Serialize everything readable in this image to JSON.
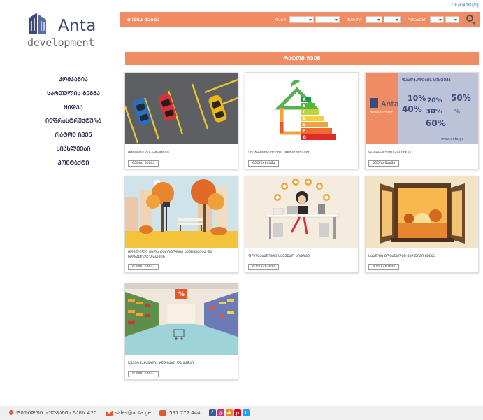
{
  "lang_switch": "GE/EN/RU/TJ",
  "logo": {
    "name": "Anta",
    "sub": "development"
  },
  "nav": [
    "ᲙᲝᲛᲞᲐᲜᲘᲐ",
    "ᲡᲐᲠᲗᲣᲚᲘᲡ ᲒᲔᲒᲛᲐ",
    "ᲧᲘᲓᲕᲐ",
    "ᲘᲜᲤᲠᲐᲡᲢᲠᲣᲥᲢᲣᲠᲐ",
    "ᲠᲐᲢᲝᲛ ᲩᲕᲔᲜ",
    "ᲡᲘᲐᲮᲚᲔᲔᲑᲘ",
    "ᲙᲝᲜᲢᲐᲥᲢᲘ"
  ],
  "search": {
    "title": "ᲑᲘᲜᲘᲡ ᲫᲔᲑᲜᲐ",
    "filter1": "ᲤᲐᲡᲘ",
    "filter2": "ᲤᲐᲠᲗᲘ",
    "filter3": "ᲝᲗᲐᲮᲔᲑᲘ",
    "icon": "search-icon"
  },
  "section_title": "ᲠᲐᲢᲝᲛ ᲩᲕᲔᲜ",
  "cards": [
    {
      "title": "ᲛᲘᲬᲘᲡᲥᲕᲔᲨᲐ ᲞᲐᲠᲙᲘᲜᲒᲘ",
      "button": "ᲛᲔᲢᲘᲡ ᲜᲐᲮᲕᲐ"
    },
    {
      "title": "ᲔᲜᲔᲠᲒᲝᲔᲤᲔᲥᲢᲣᲠᲘ ᲙᲝᲛᲞᲚᲔᲥᲡᲔᲑᲘ",
      "button": "ᲛᲔᲢᲘᲡ ᲜᲐᲮᲕᲐ"
    },
    {
      "title": "ᲤᲐᲡᲓᲐᲙᲚᲔᲑᲘᲡ ᲡᲘᲡᲢᲔᲛᲐ",
      "button": "ᲛᲔᲢᲘᲡ ᲜᲐᲮᲕᲐ"
    },
    {
      "title": "ᲛᲝᲕᲚᲘᲚᲘ ᲔᲖᲝᲡ ᲢᲔᲠᲘᲢᲝᲠᲘᲐ ᲑᲐᲕᲨᲕᲔᲑᲘᲡᲐ ᲓᲐ ᲖᲠᲓᲐᲡᲠᲣᲚᲗᲐᲗᲕᲘᲡ",
      "button": "ᲛᲔᲢᲘᲡ ᲜᲐᲮᲕᲐ"
    },
    {
      "title": "ᲤᲝᲠᲛᲐᲡᲐᲚᲣᲠᲘ ᲡᲐᲛᲣᲨᲐᲝ ᲡᲘᲕᲠᲪᲔ",
      "button": "ᲛᲔᲢᲘᲡ ᲜᲐᲮᲕᲐ"
    },
    {
      "title": "ᲡᲐᲮᲚᲘᲡ ᲛᲝᲡᲐᲬᲧᲝᲑᲘ ᲛᲐᲠᲢᲘᲕᲘ ᲒᲔᲒᲛᲐ",
      "button": "ᲛᲔᲢᲘᲡ ᲜᲐᲮᲕᲐ"
    },
    {
      "title": "ᲡᲣᲞᲔᲠᲛᲐᲠᲙᲔᲢᲘ, ᲐᲤᲗᲘᲐᲥᲘ ᲓᲐ ᲑᲐᲜᲙᲘ",
      "button": "ᲛᲔᲢᲘᲡ ᲜᲐᲮᲕᲐ"
    }
  ],
  "energy_labels": [
    "A",
    "B",
    "C",
    "D",
    "E",
    "F",
    "G"
  ],
  "promo": {
    "brand": "Anta",
    "sub": "development",
    "headline": "ᲤᲐᲡᲓᲐᲙᲚᲔᲑᲘᲡ ᲡᲘᲡᲢᲔᲛᲐ",
    "percents": [
      "10%",
      "20%",
      "30%",
      "40%",
      "50%",
      "60%",
      "%"
    ],
    "site": "www.anta.ge"
  },
  "shop_sign": "%",
  "footer": {
    "address": "ᲤᲘᲠᲘᲓᲝᲜ ᲮᲐᲚᲕᲐᲨᲘᲡ ᲒᲐᲛᲖ.#20",
    "email": "sales@anta.ge",
    "phone": "591 777 444",
    "social": [
      "f",
      "◎",
      "ok",
      "p",
      "t"
    ]
  },
  "colors": {
    "accent": "#f08c64",
    "brand_blue": "#3e4a7c"
  }
}
